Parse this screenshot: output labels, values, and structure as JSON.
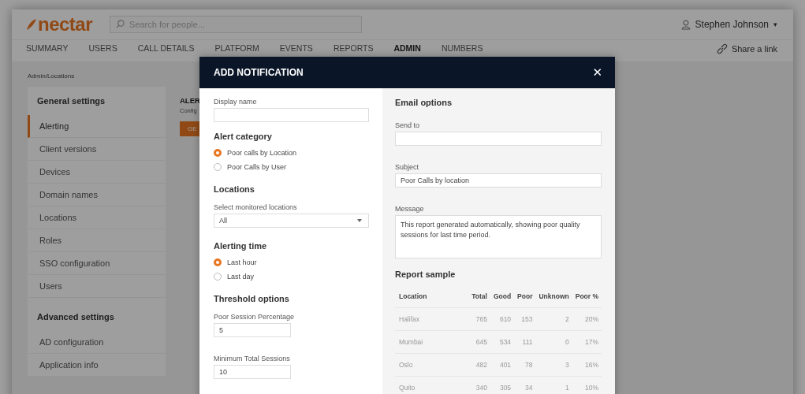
{
  "header": {
    "logo": "nectar",
    "search": {
      "placeholder": "Search for people..."
    },
    "user": "Stephen Johnson",
    "user_caret": "▾"
  },
  "nav": {
    "tabs": [
      {
        "label": "SUMMARY",
        "selected": false
      },
      {
        "label": "USERS",
        "selected": false
      },
      {
        "label": "CALL DETAILS",
        "selected": false
      },
      {
        "label": "PLATFORM",
        "selected": false
      },
      {
        "label": "EVENTS",
        "selected": false
      },
      {
        "label": "REPORTS",
        "selected": false
      },
      {
        "label": "ADMIN",
        "selected": true
      },
      {
        "label": "NUMBERS",
        "selected": false
      }
    ],
    "share_link": "Share a link"
  },
  "breadcrumb": "Admin/Locations",
  "sidebar": {
    "sections": [
      {
        "title": "General settings",
        "items": [
          {
            "label": "Alerting",
            "selected": true
          },
          {
            "label": "Client versions",
            "selected": false
          },
          {
            "label": "Devices",
            "selected": false
          },
          {
            "label": "Domain names",
            "selected": false
          },
          {
            "label": "Locations",
            "selected": false
          },
          {
            "label": "Roles",
            "selected": false
          },
          {
            "label": "SSO configuration",
            "selected": false
          },
          {
            "label": "Users",
            "selected": false
          }
        ]
      },
      {
        "title": "Advanced settings",
        "items": [
          {
            "label": "AD configuration",
            "selected": false
          },
          {
            "label": "Application info",
            "selected": false
          }
        ]
      }
    ]
  },
  "content": {
    "title": "ALER",
    "subtitle": "Config",
    "button": "GE"
  },
  "modal": {
    "title": "ADD NOTIFICATION",
    "close": "✕",
    "display_name": {
      "label": "Display name"
    },
    "alert_category": {
      "title": "Alert category",
      "options": [
        {
          "label": "Poor calls by Location",
          "selected": true
        },
        {
          "label": "Poor Calls by User",
          "selected": false
        }
      ]
    },
    "locations": {
      "title": "Locations",
      "label": "Select monitored locations",
      "value": "All"
    },
    "alerting_time": {
      "title": "Alerting time",
      "options": [
        {
          "label": "Last hour",
          "selected": true
        },
        {
          "label": "Last day",
          "selected": false
        }
      ]
    },
    "threshold": {
      "title": "Threshold options",
      "fields": [
        {
          "label": "Poor Session Percentage",
          "value": "5"
        },
        {
          "label": "Minimum Total Sessions",
          "value": "10"
        }
      ]
    },
    "email": {
      "title": "Email options",
      "send_to": {
        "label": "Send to"
      },
      "subject": {
        "label": "Subject",
        "value": "Poor Calls by location"
      },
      "message": {
        "label": "Message",
        "value": "This report generated automatically, showing poor quality sessions for last time period."
      }
    },
    "report": {
      "title": "Report sample",
      "columns": [
        "Location",
        "Total",
        "Good",
        "Poor",
        "Unknown",
        "Poor %"
      ],
      "rows": [
        [
          "Halifax",
          "765",
          "610",
          "153",
          "2",
          "20%"
        ],
        [
          "Mumbai",
          "645",
          "534",
          "111",
          "0",
          "17%"
        ],
        [
          "Oslo",
          "482",
          "401",
          "78",
          "3",
          "16%"
        ],
        [
          "Quito",
          "340",
          "305",
          "34",
          "1",
          "10%"
        ]
      ]
    }
  }
}
